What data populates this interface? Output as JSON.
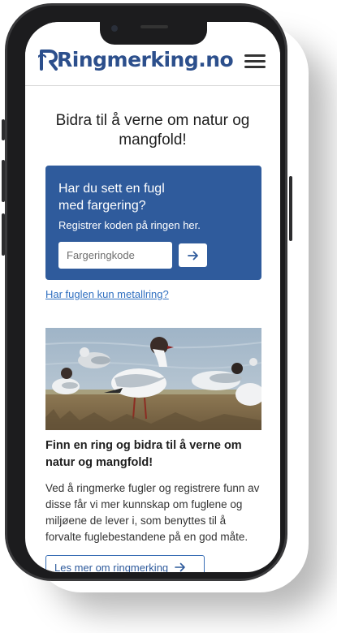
{
  "header": {
    "logo_text": "Ringmerking.no",
    "menu_icon": "hamburger-menu-icon"
  },
  "hero": {
    "title": "Bidra til å verne om natur og mangfold!"
  },
  "register": {
    "question": "Har du sett en fugl med fargering?",
    "subtitle": "Registrer koden på ringen her.",
    "input_placeholder": "Fargeringkode",
    "submit_icon": "arrow-right-icon"
  },
  "metal_ring_link": "Har fuglen kun metallring?",
  "card": {
    "image": "black-headed-gulls-photo",
    "title": "Finn en ring og bidra til å verne om natur og mangfold!",
    "body": "Ved å ringmerke fugler og registrere funn av disse får vi mer kunnskap om fuglene og miljøene de lever i, som benyttes til å forvalte fuglebestandene på en god måte.",
    "more_label": "Les mer om ringmerking"
  },
  "colors": {
    "brand_blue": "#2f5b9c",
    "link_blue": "#2f6fc0"
  }
}
